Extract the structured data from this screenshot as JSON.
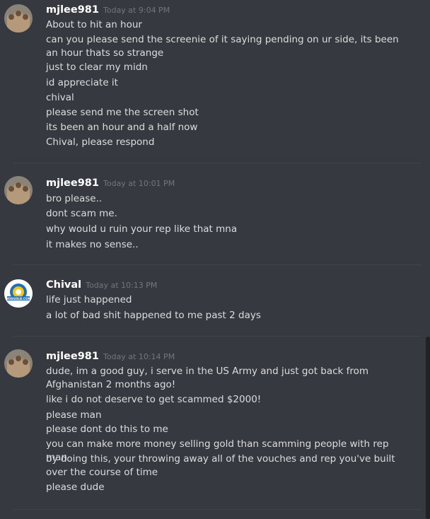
{
  "messages": [
    {
      "author": "mjlee981",
      "timestamp": "Today at 9:04 PM",
      "avatar_icon": "user-photo-avatar",
      "lines": [
        "About to hit an hour",
        "can you please send the screenie of it saying pending on ur side, its been an hour thats so strange",
        "just to clear my midn",
        "id appreciate it",
        "chival",
        "please send me the screen shot",
        "its been an hour and a half now",
        "Chival, please respond"
      ]
    },
    {
      "author": "mjlee981",
      "timestamp": "Today at 10:01 PM",
      "avatar_icon": "user-photo-avatar",
      "lines": [
        "bro please..",
        "dont scam me.",
        "why would u ruin your rep like that mna",
        "it makes no sense.."
      ]
    },
    {
      "author": "Chival",
      "timestamp": "Today at 10:13 PM",
      "avatar_icon": "nosgold-logo-avatar",
      "avatar_logo_text": "NOSGOLD.COM",
      "lines": [
        "life just happened",
        "a lot of bad shit happened to me past 2 days"
      ]
    },
    {
      "author": "mjlee981",
      "timestamp": "Today at 10:14 PM",
      "avatar_icon": "user-photo-avatar",
      "lines": [
        "dude, im a good guy, i serve in the US Army and just got back from Afghanistan 2 months ago!",
        "like i do not deserve to get scammed $2000!",
        "please man",
        "please dont do this to me",
        "you can make more money selling gold than scamming people with rep man",
        "by doing this, your throwing away all of the vouches and rep you've built over the course of time",
        "please dude"
      ]
    }
  ],
  "colors": {
    "background": "#36393f",
    "author": "#ffffff",
    "timestamp": "#72767d",
    "message_text": "#dcddde",
    "divider": "#40434a",
    "logo_yellow": "#f5c518",
    "logo_blue": "#1f6fb5"
  }
}
